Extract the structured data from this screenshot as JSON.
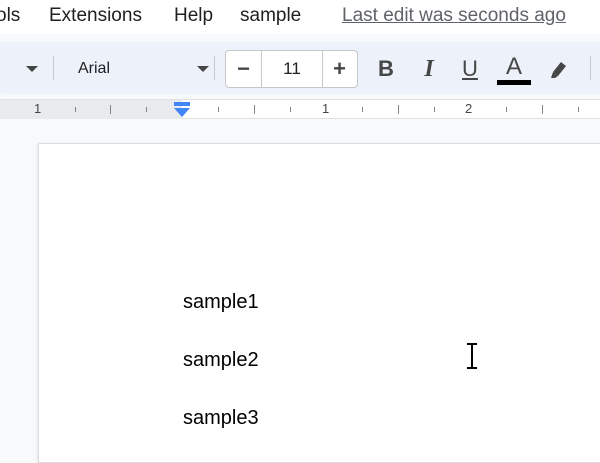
{
  "menubar": {
    "tools_partial": "ols",
    "extensions": "Extensions",
    "help": "Help",
    "sample": "sample",
    "last_edit": "Last edit was seconds ago"
  },
  "toolbar": {
    "font_name": "Arial",
    "font_size": "11",
    "minus_label": "−",
    "plus_label": "+",
    "bold_label": "B",
    "italic_label": "I",
    "underline_label": "U",
    "text_color_label": "A",
    "text_color": "#000000"
  },
  "ruler": {
    "numbers": [
      "1",
      "1",
      "2"
    ]
  },
  "document": {
    "lines": [
      "sample1",
      "sample2",
      "sample3"
    ]
  },
  "colors": {
    "accent": "#4285f4",
    "toolbar_bg": "#edf2fa"
  }
}
